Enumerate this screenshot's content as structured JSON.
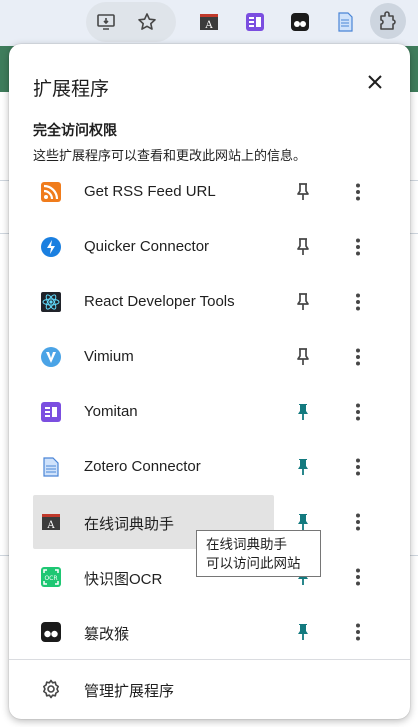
{
  "panel": {
    "title": "扩展程序",
    "section_heading": "完全访问权限",
    "section_desc": "这些扩展程序可以查看和更改此网站上的信息。",
    "extensions": [
      {
        "name": "Get RSS Feed URL",
        "icon": "rss-feed-icon",
        "pinned": false
      },
      {
        "name": "Quicker Connector",
        "icon": "lightning-bolt-icon",
        "pinned": false
      },
      {
        "name": "React Developer Tools",
        "icon": "react-atom-icon",
        "pinned": false
      },
      {
        "name": "Vimium",
        "icon": "vimium-v-icon",
        "pinned": false
      },
      {
        "name": "Yomitan",
        "icon": "yomitan-icon",
        "pinned": true
      },
      {
        "name": "Zotero Connector",
        "icon": "zotero-page-icon",
        "pinned": true
      },
      {
        "name": "在线词典助手",
        "icon": "dictionary-icon",
        "pinned": true
      },
      {
        "name": "快识图OCR",
        "icon": "ocr-icon",
        "pinned": true
      },
      {
        "name": "篡改猴",
        "icon": "tampermonkey-icon",
        "pinned": true
      }
    ],
    "manage_label": "管理扩展程序"
  },
  "tooltip": {
    "line1": "在线词典助手",
    "line2": "可以访问此网站"
  },
  "colors": {
    "pinned": "#137a7f",
    "unpinned": "#474747",
    "highlight": "#e3e3e3",
    "toolbar": "#e9eef6"
  }
}
